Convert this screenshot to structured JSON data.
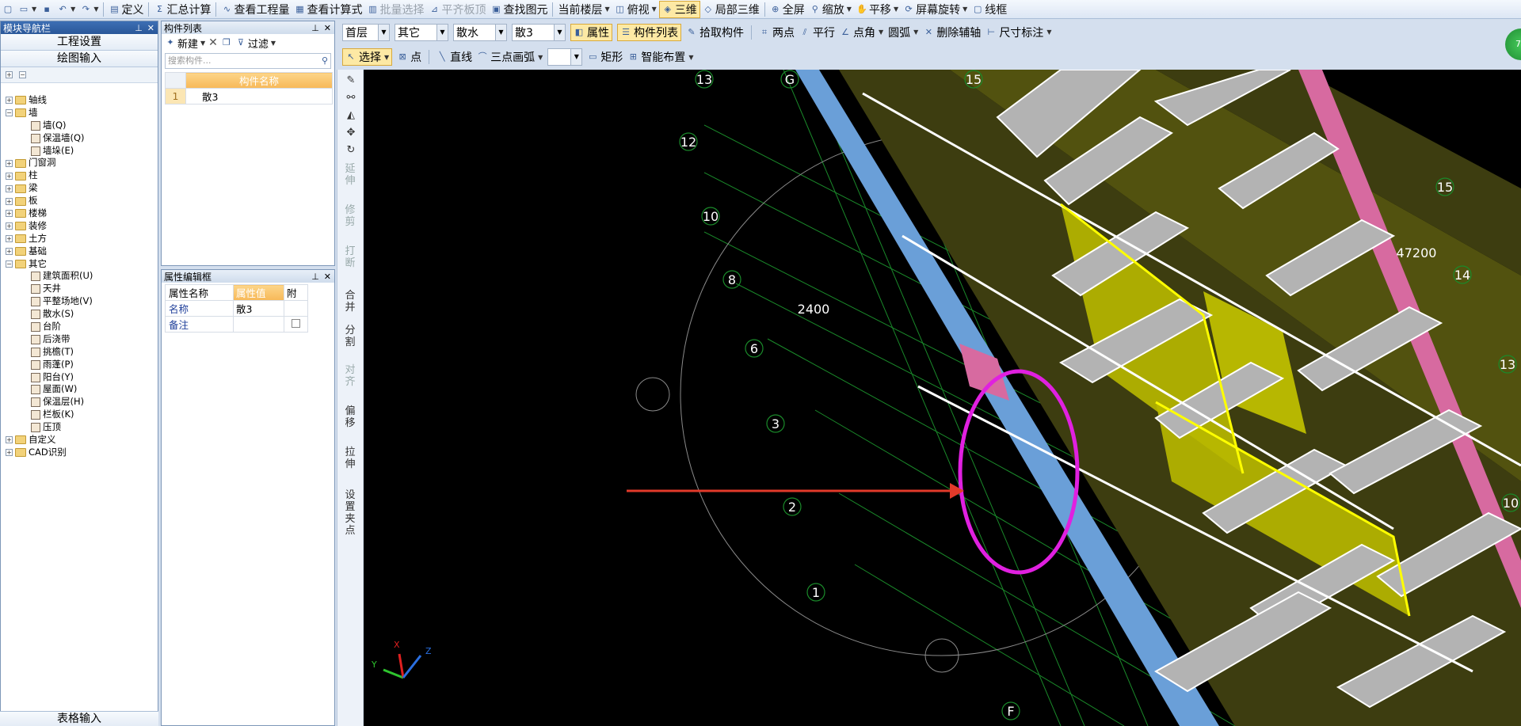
{
  "toolbar": {
    "items": [
      "定义",
      "汇总计算",
      "查看工程量",
      "查看计算式",
      "批量选择",
      "平齐板顶",
      "查找图元",
      "当前楼层",
      "俯视",
      "三维",
      "局部三维",
      "全屏",
      "缩放",
      "平移",
      "屏幕旋转",
      "线框"
    ]
  },
  "nav": {
    "title": "模块导航栏",
    "btn1": "工程设置",
    "btn2": "绘图输入",
    "bottom": "表格输入",
    "tree": {
      "axis": "轴线",
      "wall": "墙",
      "wall_sub": [
        "墙(Q)",
        "保温墙(Q)",
        "墙垛(E)"
      ],
      "door": "门窗洞",
      "column": "柱",
      "beam": "梁",
      "slab": "板",
      "stair": "楼梯",
      "deco": "装修",
      "earth": "土方",
      "found": "基础",
      "other": "其它",
      "other_sub": [
        "建筑面积(U)",
        "天井",
        "平整场地(V)",
        "散水(S)",
        "台阶",
        "后浇带",
        "挑檐(T)",
        "雨蓬(P)",
        "阳台(Y)",
        "屋面(W)",
        "保温层(H)",
        "栏板(K)",
        "压顶"
      ],
      "custom": "自定义",
      "cad": "CAD识别"
    }
  },
  "components": {
    "title": "构件列表",
    "new": "新建",
    "filter": "过滤",
    "search_placeholder": "搜索构件...",
    "col_header": "构件名称",
    "rows": [
      {
        "index": "1",
        "name": "散3"
      }
    ]
  },
  "properties": {
    "title": "属性编辑框",
    "headers": [
      "属性名称",
      "属性值",
      "附"
    ],
    "rows": [
      {
        "name": "名称",
        "value": "散3"
      },
      {
        "name": "备注",
        "value": ""
      }
    ]
  },
  "row2": {
    "floor": "首层",
    "type": "其它",
    "sub": "散水",
    "name": "散3",
    "property": "属性",
    "list": "构件列表",
    "pick": "拾取构件",
    "two_point": "两点",
    "parallel": "平行",
    "point_angle": "点角",
    "arc": "圆弧",
    "del_aux": "删除辅轴",
    "dim": "尺寸标注"
  },
  "row3": {
    "select": "选择",
    "point": "点",
    "line": "直线",
    "arc3": "三点画弧",
    "rect": "矩形",
    "smart": "智能布置"
  },
  "vtools": [
    "延伸",
    "修剪",
    "打断",
    "合并",
    "分割",
    "对齐",
    "偏移",
    "拉伸",
    "设置夹点"
  ],
  "viewport": {
    "axis_labels": [
      "13",
      "12",
      "10",
      "8",
      "6",
      "3",
      "2",
      "1",
      "G",
      "15",
      "15",
      "14",
      "13",
      "10",
      "F"
    ],
    "dims": [
      "47200",
      "2400"
    ],
    "axes": [
      "X",
      "Y",
      "Z"
    ]
  },
  "colors": {
    "wall": "#b3b3b3",
    "yellow": "#b8b800",
    "pink": "#d76aa0",
    "blue": "#6a9fd8",
    "annot": "#e020e0",
    "arrow": "#e23a2a"
  }
}
